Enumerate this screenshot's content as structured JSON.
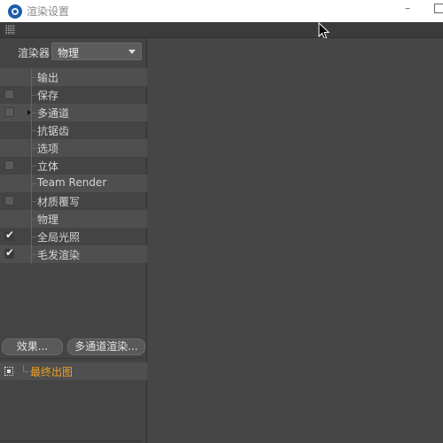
{
  "window": {
    "title": "渲染设置",
    "min_glyph": "–"
  },
  "renderer": {
    "label": "渲染器",
    "value": "物理"
  },
  "tree": [
    {
      "label": "输出",
      "checkbox": "none",
      "alt": true,
      "expander": false
    },
    {
      "label": "保存",
      "checkbox": "off",
      "alt": false,
      "expander": false
    },
    {
      "label": "多通道",
      "checkbox": "off",
      "alt": true,
      "expander": true
    },
    {
      "label": "抗锯齿",
      "checkbox": "none",
      "alt": false,
      "expander": false
    },
    {
      "label": "选项",
      "checkbox": "none",
      "alt": true,
      "expander": false
    },
    {
      "label": "立体",
      "checkbox": "off",
      "alt": false,
      "expander": false
    },
    {
      "label": "Team Render",
      "checkbox": "none",
      "alt": true,
      "expander": false
    },
    {
      "label": "材质覆写",
      "checkbox": "off",
      "alt": false,
      "expander": false
    },
    {
      "label": "物理",
      "checkbox": "none",
      "alt": true,
      "expander": false
    },
    {
      "label": "全局光照",
      "checkbox": "on",
      "alt": false,
      "expander": false
    },
    {
      "label": "毛发渲染",
      "checkbox": "on",
      "alt": true,
      "expander": false
    }
  ],
  "buttons": {
    "effects": "效果...",
    "multipass": "多通道渲染..."
  },
  "output": {
    "label": "最终出图"
  },
  "colors": {
    "output_accent": "#f0a020",
    "panel_bg": "#444444"
  }
}
